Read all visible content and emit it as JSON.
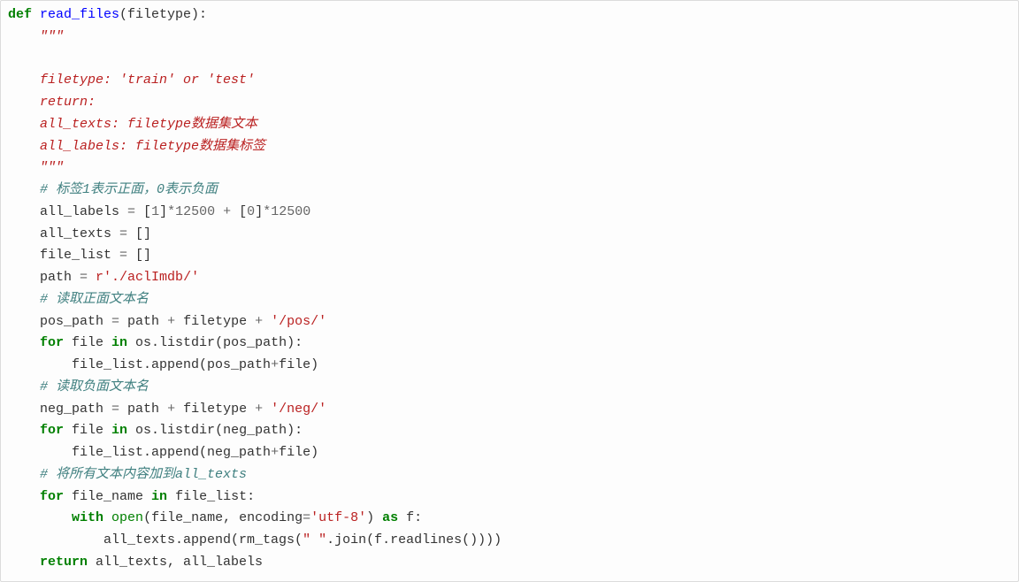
{
  "code": {
    "def": "def",
    "fn": "read_files",
    "argline_tail": "(filetype):",
    "doc_open": "    \"\"\"",
    "doc_l1": "    filetype: 'train' or 'test'",
    "doc_l2": "    return:",
    "doc_l3": "    all_texts: filetype数据集文本",
    "doc_l4": "    all_labels: filetype数据集标签",
    "doc_close": "    \"\"\"",
    "c1": "    # 标签1表示正面，0表示负面",
    "al1_a": "    all_labels ",
    "al1_eq": "=",
    "al1_b": " [",
    "al1_n1": "1",
    "al1_c": "]",
    "al1_star": "*",
    "al1_n2": "12500",
    "al1_d": " ",
    "al1_plus": "+",
    "al1_e": " [",
    "al1_n3": "0",
    "al1_f": "]",
    "al1_star2": "*",
    "al1_n4": "12500",
    "at_a": "    all_texts ",
    "at_eq": "=",
    "at_b": " []",
    "fl_a": "    file_list ",
    "fl_eq": "=",
    "fl_b": " []",
    "path_a": "    path ",
    "path_eq": "=",
    "path_b": " ",
    "path_s": "r'./aclImdb/'",
    "c2": "    # 读取正面文本名",
    "pp_a": "    pos_path ",
    "pp_eq": "=",
    "pp_b": " path ",
    "pp_plus": "+",
    "pp_c": " filetype ",
    "pp_plus2": "+",
    "pp_d": " ",
    "pp_s": "'/pos/'",
    "for1_for": "    for",
    "for1_mid": " file ",
    "for1_in": "in",
    "for1_tail": " os.listdir(pos_path):",
    "for1_body_a": "        file_list.append(pos_path",
    "for1_body_plus": "+",
    "for1_body_b": "file)",
    "c3": "    # 读取负面文本名",
    "np_a": "    neg_path ",
    "np_eq": "=",
    "np_b": " path ",
    "np_plus": "+",
    "np_c": " filetype ",
    "np_plus2": "+",
    "np_d": " ",
    "np_s": "'/neg/'",
    "for2_for": "    for",
    "for2_mid": " file ",
    "for2_in": "in",
    "for2_tail": " os.listdir(neg_path):",
    "for2_body_a": "        file_list.append(neg_path",
    "for2_body_plus": "+",
    "for2_body_b": "file)",
    "c4": "    # 将所有文本内容加到all_texts",
    "for3_for": "    for",
    "for3_mid": " file_name ",
    "for3_in": "in",
    "for3_tail": " file_list:",
    "with_kw": "        with",
    "with_a": " ",
    "open_kw": "open",
    "with_b": "(file_name, encoding",
    "with_eq": "=",
    "with_s": "'utf-8'",
    "with_c": ") ",
    "as_kw": "as",
    "with_d": " f:",
    "append_a": "            all_texts.append(rm_tags(",
    "append_s": "\" \"",
    "append_b": ".join(f.readlines())))",
    "ret_kw": "    return",
    "ret_tail": " all_texts, all_labels"
  }
}
